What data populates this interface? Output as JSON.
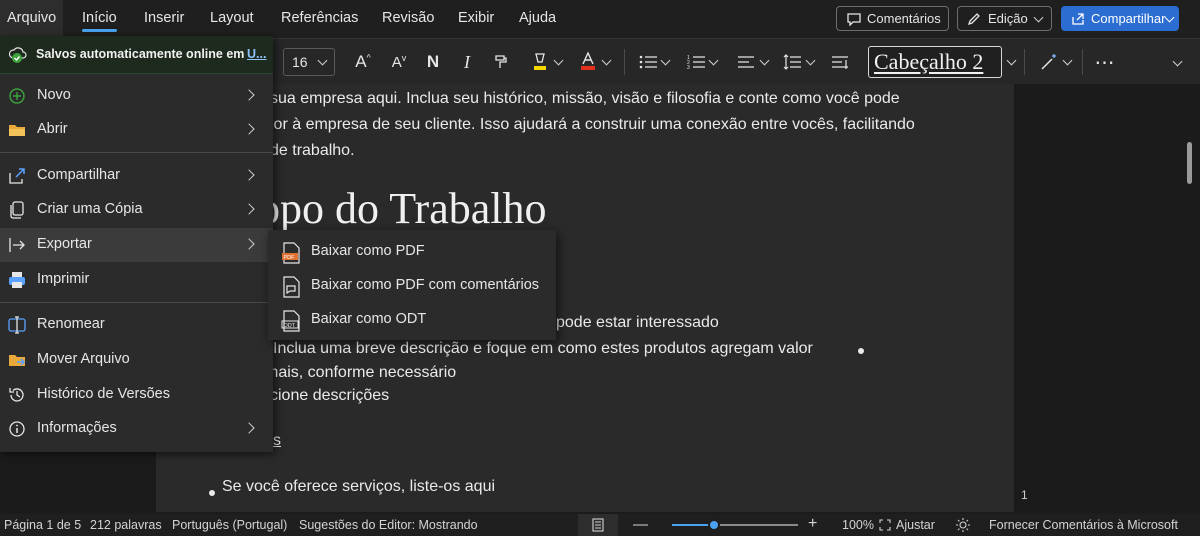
{
  "menubar": {
    "tabs": [
      "Arquivo",
      "Início",
      "Inserir",
      "Layout",
      "Referências",
      "Revisão",
      "Exibir",
      "Ajuda"
    ],
    "comments_label": "Comentários",
    "editing_label": "Edição",
    "share_label": "Compartilhar"
  },
  "ribbon": {
    "font_size": "16",
    "style_name": "Cabeçalho 2"
  },
  "file_menu": {
    "saved_text": "Salvos automaticamente online em",
    "saved_link": "U...",
    "items": [
      {
        "label": "Novo",
        "icon": "plus-circle-icon",
        "has_submenu": true
      },
      {
        "label": "Abrir",
        "icon": "folder-icon",
        "has_submenu": true
      },
      {
        "label": "Compartilhar",
        "icon": "share-icon",
        "has_submenu": true
      },
      {
        "label": "Criar uma Cópia",
        "icon": "copy-icon",
        "has_submenu": true
      },
      {
        "label": "Exportar",
        "icon": "export-icon",
        "has_submenu": true
      },
      {
        "label": "Imprimir",
        "icon": "printer-icon",
        "has_submenu": false
      },
      {
        "label": "Renomear",
        "icon": "rename-icon",
        "has_submenu": false
      },
      {
        "label": "Mover Arquivo",
        "icon": "move-folder-icon",
        "has_submenu": false
      },
      {
        "label": "Histórico de Versões",
        "icon": "history-icon",
        "has_submenu": false
      },
      {
        "label": "Informações",
        "icon": "info-icon",
        "has_submenu": true
      }
    ]
  },
  "export_submenu": {
    "items": [
      {
        "label": "Baixar como PDF",
        "icon": "pdf-file-icon"
      },
      {
        "label": "Baixar como PDF com comentários",
        "icon": "pdf-comments-file-icon"
      },
      {
        "label": "Baixar como ODT",
        "icon": "odt-file-icon"
      }
    ]
  },
  "document": {
    "para_line1": "sua empresa aqui. Inclua seu histórico, missão, visão e filosofia e conte como você pode",
    "para_line2": "lor à empresa de seu cliente. Isso ajudará a construir uma conexão entre vocês, facilitando",
    "para_line3": "de trabalho.",
    "heading": "opo do Trabalho",
    "line_interest": "pode estar interessado",
    "line_desc": "Inclua uma breve descrição e foque em como estes produtos agregam valor",
    "line_more": "mais, conforme necessário",
    "line_add": "cione descrições",
    "line_s": "s",
    "line_services": "Se você oferece serviços, liste-os aqui",
    "page_number": "1"
  },
  "status": {
    "page": "Página 1 de 5",
    "words": "212 palavras",
    "language": "Português (Portugal)",
    "editor": "Sugestões do Editor: Mostrando",
    "zoom": "100%",
    "zoom_level": 0.33,
    "fit": "Ajustar",
    "feedback": "Fornecer Comentários à Microsoft"
  },
  "colors": {
    "accent": "#2b6dd1",
    "highlight_yellow": "#f5d800",
    "font_red": "#e0301e",
    "pdf_orange": "#e07030",
    "saved_green": "#3ea33e"
  }
}
